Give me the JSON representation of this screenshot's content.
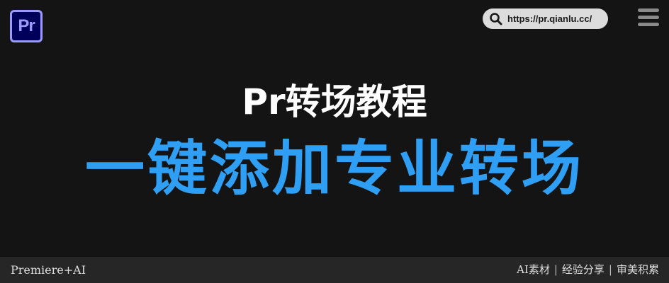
{
  "header": {
    "logo_text": "Pr",
    "url": "https://pr.qianlu.cc/"
  },
  "main": {
    "subtitle": "Pr转场教程",
    "headline": "一键添加专业转场"
  },
  "footer": {
    "left_text": "Premiere+AI",
    "right_items": [
      "AI素材",
      "经验分享",
      "审美积累"
    ],
    "separator": "|"
  },
  "colors": {
    "background": "#141414",
    "headline": "#2e9ff5",
    "logo_bg": "#00005b",
    "logo_accent": "#9b9bff",
    "footer_bg": "#262626"
  },
  "icons": {
    "search": "search-icon",
    "menu": "hamburger-menu-icon"
  }
}
